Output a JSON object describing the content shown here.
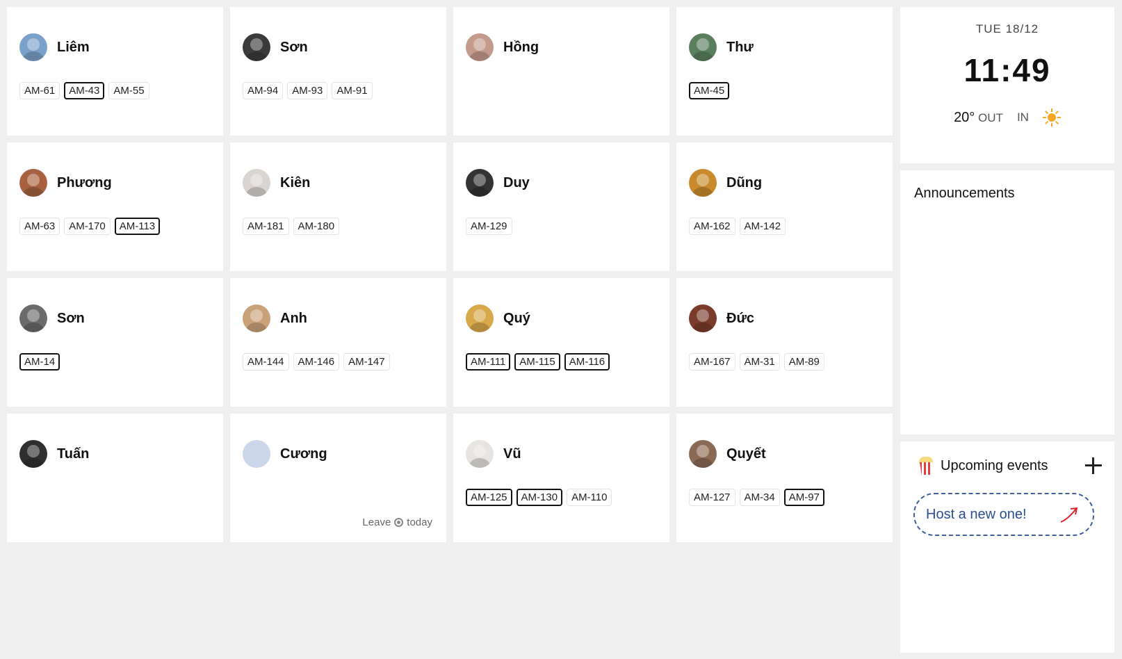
{
  "colors": {
    "background": "#efefef",
    "card": "#ffffff",
    "accent": "#2a4e8f",
    "sun": "#f5a623"
  },
  "people": [
    {
      "name": "Liêm",
      "avatar_color": "#7aa1c9",
      "tags": [
        {
          "id": "AM-61",
          "active": false
        },
        {
          "id": "AM-43",
          "active": true
        },
        {
          "id": "AM-55",
          "active": false
        }
      ]
    },
    {
      "name": "Sơn",
      "avatar_color": "#3b3b3b",
      "tags": [
        {
          "id": "AM-94",
          "active": false
        },
        {
          "id": "AM-93",
          "active": false
        },
        {
          "id": "AM-91",
          "active": false
        }
      ]
    },
    {
      "name": "Hồng",
      "avatar_color": "#c49a8a",
      "tags": []
    },
    {
      "name": "Thư",
      "avatar_color": "#5a7f5c",
      "tags": [
        {
          "id": "AM-45",
          "active": true
        }
      ]
    },
    {
      "name": "Phương",
      "avatar_color": "#a8613f",
      "tags": [
        {
          "id": "AM-63",
          "active": false
        },
        {
          "id": "AM-170",
          "active": false
        },
        {
          "id": "AM-113",
          "active": true
        }
      ]
    },
    {
      "name": "Kiên",
      "avatar_color": "#d9d4cf",
      "tags": [
        {
          "id": "AM-181",
          "active": false
        },
        {
          "id": "AM-180",
          "active": false
        }
      ]
    },
    {
      "name": "Duy",
      "avatar_color": "#333333",
      "tags": [
        {
          "id": "AM-129",
          "active": false
        }
      ]
    },
    {
      "name": "Dũng",
      "avatar_color": "#c98a2e",
      "tags": [
        {
          "id": "AM-162",
          "active": false
        },
        {
          "id": "AM-142",
          "active": false
        }
      ]
    },
    {
      "name": "Sơn",
      "avatar_color": "#6b6b6b",
      "tags": [
        {
          "id": "AM-14",
          "active": true
        }
      ]
    },
    {
      "name": "Anh",
      "avatar_color": "#c9a27a",
      "tags": [
        {
          "id": "AM-144",
          "active": false
        },
        {
          "id": "AM-146",
          "active": false
        },
        {
          "id": "AM-147",
          "active": false
        }
      ]
    },
    {
      "name": "Quý",
      "avatar_color": "#d8a84a",
      "tags": [
        {
          "id": "AM-111",
          "active": true
        },
        {
          "id": "AM-115",
          "active": true
        },
        {
          "id": "AM-116",
          "active": true
        }
      ]
    },
    {
      "name": "Đức",
      "avatar_color": "#7a3b2a",
      "tags": [
        {
          "id": "AM-167",
          "active": false
        },
        {
          "id": "AM-31",
          "active": false
        },
        {
          "id": "AM-89",
          "active": false
        }
      ]
    },
    {
      "name": "Tuấn",
      "avatar_color": "#2f2f2f",
      "tags": []
    },
    {
      "name": "Cương",
      "avatar_color": "#ccd6ea",
      "avatar_empty": true,
      "tags": [],
      "status": {
        "before": "Leave",
        "after": "today"
      }
    },
    {
      "name": "Vũ",
      "avatar_color": "#e6e3e0",
      "tags": [
        {
          "id": "AM-125",
          "active": true
        },
        {
          "id": "AM-130",
          "active": true
        },
        {
          "id": "AM-110",
          "active": false
        }
      ]
    },
    {
      "name": "Quyết",
      "avatar_color": "#8a6a55",
      "tags": [
        {
          "id": "AM-127",
          "active": false
        },
        {
          "id": "AM-34",
          "active": false
        },
        {
          "id": "AM-97",
          "active": true
        }
      ]
    }
  ],
  "clock": {
    "date": "TUE 18/12",
    "time": "11:49",
    "temp": "20°",
    "out_label": "OUT",
    "in_label": "IN",
    "weather_icon": "sun-icon"
  },
  "announcements": {
    "title": "Announcements"
  },
  "events": {
    "icon": "popcorn-icon",
    "title": "Upcoming events",
    "host_label": "Host a new one!"
  }
}
